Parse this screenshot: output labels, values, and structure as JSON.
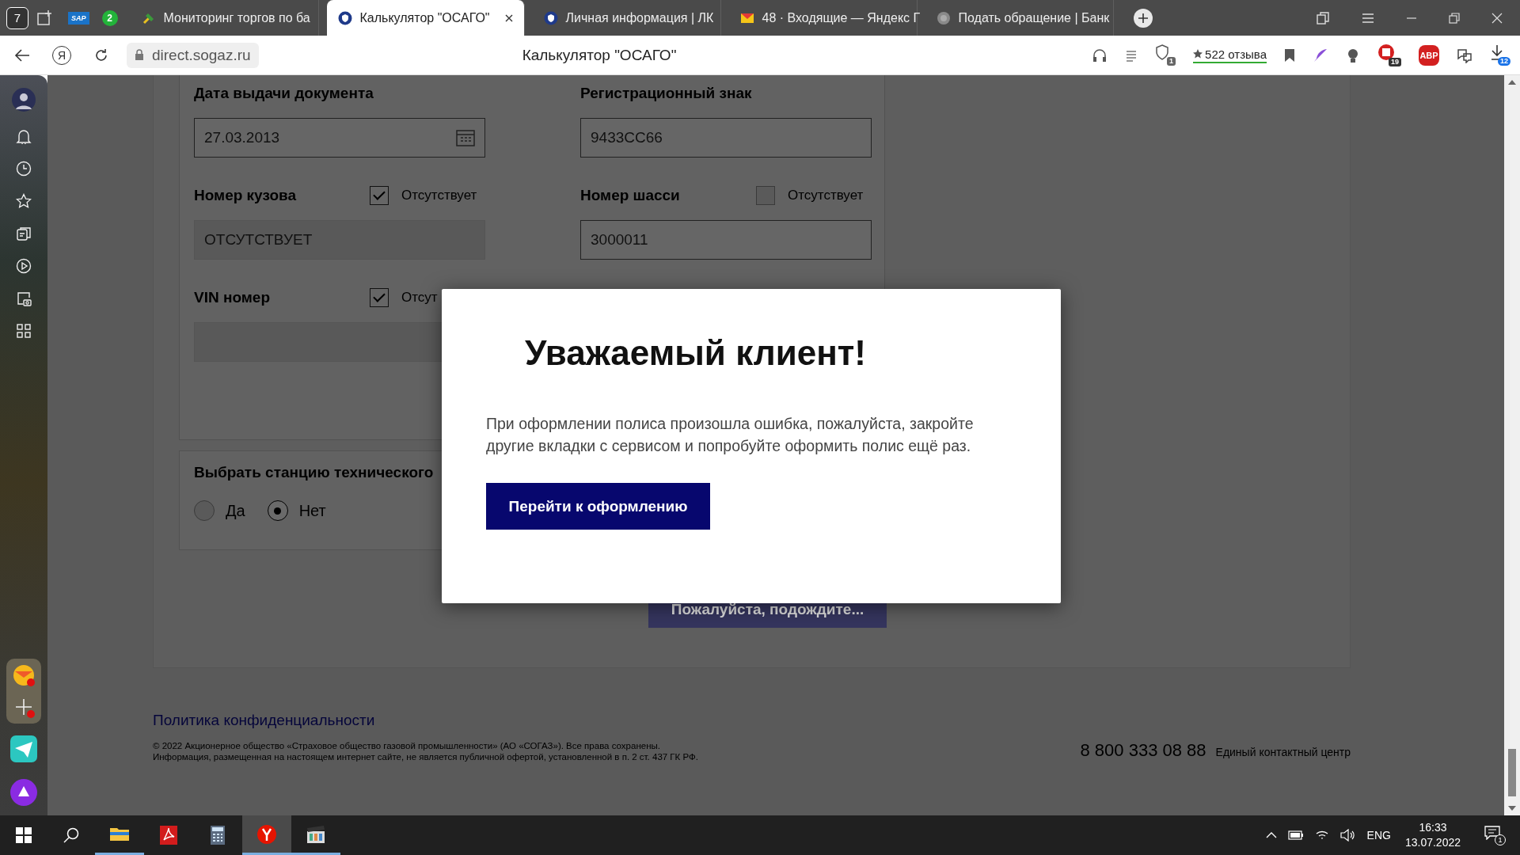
{
  "browser": {
    "tab_counter": "7",
    "pinned": [
      {
        "kind": "sap",
        "label": "SAP"
      },
      {
        "kind": "chat",
        "label": "2"
      }
    ],
    "tabs": [
      {
        "kind": "hammer",
        "label": "Мониторинг торгов по ба",
        "selected": false
      },
      {
        "kind": "shield",
        "label": "Калькулятор \"ОСАГО\"",
        "selected": true
      },
      {
        "kind": "shield",
        "label": "Личная информация | ЛК",
        "selected": false
      },
      {
        "kind": "mail",
        "label": "48 · Входящие — Яндекс Г",
        "selected": false
      },
      {
        "kind": "faded",
        "label": "Подать обращение | Банк",
        "selected": false
      }
    ],
    "yandex_button": "Я",
    "address": "direct.sogaz.ru",
    "page_title": "Калькулятор \"ОСАГО\"",
    "reviews": "522 отзыва",
    "shield_badge": "1",
    "counter_badge": "19",
    "adblock": "ABP",
    "downloads_badge": "12"
  },
  "form": {
    "fields": [
      {
        "kind": "date",
        "label": "Дата выдачи документа",
        "value": "27.03.2013",
        "disabled": false
      },
      {
        "kind": "text",
        "label": "Регистрационный знак",
        "value": "9433CC66",
        "disabled": false
      },
      {
        "kind": "text",
        "label": "Номер кузова",
        "value": "ОТСУТСТВУЕТ",
        "disabled": true,
        "absent_label": "Отсутствует",
        "absent_checked": true
      },
      {
        "kind": "text",
        "label": "Номер шасси",
        "value": "3000011",
        "disabled": false,
        "absent_label": "Отсутствует",
        "absent_checked": false
      },
      {
        "kind": "text",
        "label": "VIN номер",
        "disabled": true,
        "absent_label": "Отсут",
        "absent_checked": true
      }
    ],
    "station": {
      "label": "Выбрать станцию технического",
      "options": [
        {
          "label": "Да",
          "selected": false
        },
        {
          "label": "Нет",
          "selected": true
        }
      ]
    },
    "wait_button": "Пожалуйста, подождите..."
  },
  "dialog": {
    "title": "Уважаемый клиент!",
    "message": "При оформлении полиса произошла ошибка, пожалуйста, закройте другие вкладки с сервисом и попробуйте оформить полис ещё раз.",
    "button": "Перейти к оформлению"
  },
  "footer": {
    "privacy_link": "Политика конфиденциальности",
    "copyright": [
      "© 2022 Акционерное общество «Страховое общество газовой промышленности» (АО «СОГАЗ»). Все права сохранены.",
      "Информация, размещенная на настоящем интернет сайте, не является публичной офертой, установленной в п. 2 ст. 437 ГК РФ."
    ],
    "phone": "8 800 333 08 88",
    "phone_caption": "Единый контактный центр"
  },
  "taskbar": {
    "apps": [
      {
        "kind": "explorer",
        "selected": false,
        "running": true
      },
      {
        "kind": "acrobat",
        "selected": false,
        "running": false
      },
      {
        "kind": "calculator",
        "selected": false,
        "running": false
      },
      {
        "kind": "yandex",
        "selected": true,
        "running": true
      },
      {
        "kind": "clapper",
        "selected": false,
        "running": true
      }
    ],
    "lang": "ENG",
    "time": "16:33",
    "date": "13.07.2022",
    "notifications": "1"
  }
}
